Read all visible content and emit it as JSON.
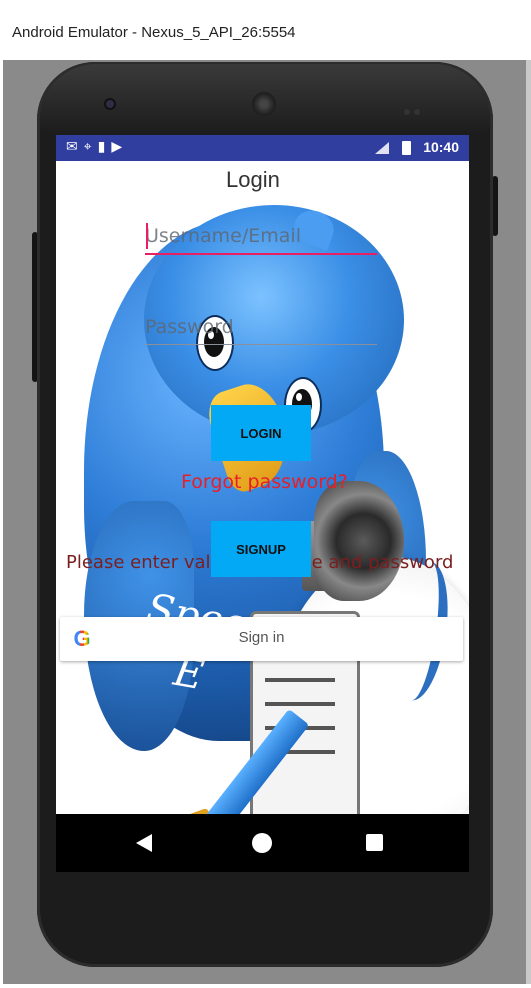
{
  "window": {
    "title": "Android Emulator - Nexus_5_API_26:5554"
  },
  "statusbar": {
    "left_icons": [
      "gmail-icon",
      "location-icon",
      "sd-card-icon",
      "play-store-icon"
    ],
    "network": "LTE",
    "time": "10:40",
    "color": "#303f9f"
  },
  "app": {
    "title": "Login",
    "username_placeholder": "Username/Email",
    "username_value": "",
    "password_placeholder": "Password",
    "password_value": "",
    "login_label": "LOGIN",
    "forgot_label": "Forgot password?",
    "signup_label": "SIGNUP",
    "hint_text": "Please enter valid username and password",
    "google_label": "Sign in",
    "google_glyph": "G",
    "illustration_text_line1": "Speech",
    "illustration_text_line2": "E",
    "accent_color": "#e91e63",
    "button_color": "#03a9f4",
    "error_color": "#e5202a"
  },
  "navbar": {
    "back": "back-icon",
    "home": "home-icon",
    "recents": "recents-icon"
  }
}
